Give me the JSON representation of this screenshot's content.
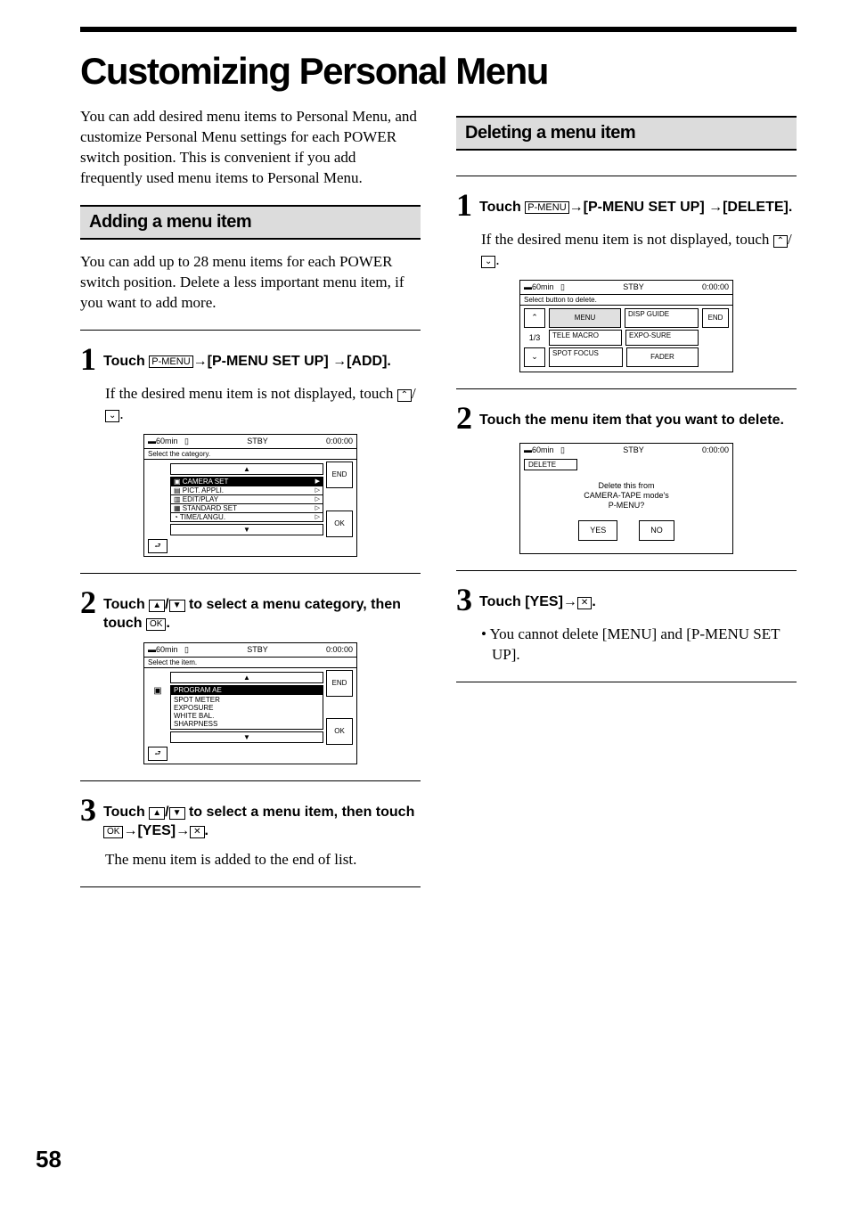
{
  "page_title": "Customizing Personal Menu",
  "intro": "You can add desired menu items to Personal Menu, and customize Personal Menu settings for each POWER switch position. This is convenient if you add frequently used menu items to Personal Menu.",
  "page_number": "58",
  "keycaps": {
    "pmenu": "P-MENU",
    "ok": "OK",
    "x": "✕",
    "up": "▲",
    "down": "▼",
    "chev_up": "⌃",
    "chev_down": "⌄"
  },
  "section_add": {
    "title": "Adding a menu item",
    "intro": "You can add up to 28 menu items for each POWER switch position. Delete a less important menu item, if you want to add more.",
    "step1": {
      "text_pre": "Touch ",
      "text_mid1": "→[P-MENU SET UP] →[ADD].",
      "followup_pre": "If the desired menu item is not displayed, touch ",
      "followup_post": "."
    },
    "step2": {
      "text_pre": "Touch ",
      "text_mid": " to select a menu category, then touch ",
      "text_post": "."
    },
    "step3": {
      "text_pre": "Touch ",
      "text_mid1": " to select a menu item, then touch ",
      "text_mid2": "→[YES]→",
      "text_post": ".",
      "followup": "The menu item is added to the end of list."
    }
  },
  "section_delete": {
    "title": "Deleting a menu item",
    "step1": {
      "text_pre": "Touch ",
      "text_mid1": "→[P-MENU SET UP] →[DELETE].",
      "followup_pre": "If the desired menu item is not displayed, touch ",
      "followup_post": "."
    },
    "step2": {
      "text": "Touch the menu item that you want to delete."
    },
    "step3": {
      "text_pre": "Touch [YES]→",
      "text_post": ".",
      "followup": "• You cannot delete [MENU] and [P-MENU SET UP]."
    }
  },
  "screenshot_common": {
    "battery": "60min",
    "status": "STBY",
    "time": "0:00:00",
    "end": "END",
    "ok": "OK",
    "back": "⮐",
    "up": "▲",
    "down": "▼"
  },
  "screenshot_add1": {
    "title": "Select the category.",
    "items": [
      "CAMERA SET",
      "PICT. APPLI.",
      "EDIT/PLAY",
      "STANDARD SET",
      "TIME/LANGU."
    ]
  },
  "screenshot_add2": {
    "title": "Select the item.",
    "items": [
      "PROGRAM AE",
      "SPOT METER",
      "EXPOSURE",
      "WHITE BAL.",
      "SHARPNESS"
    ]
  },
  "screenshot_del1": {
    "title": "Select button to delete.",
    "page": "1/3",
    "buttons": [
      "MENU",
      "DISP GUIDE",
      "TELE MACRO",
      "EXPO-SURE",
      "SPOT FOCUS",
      "FADER"
    ],
    "end": "END"
  },
  "screenshot_del2": {
    "title": "DELETE",
    "message": "Delete this from\nCAMERA-TAPE mode's\nP-MENU?",
    "yes": "YES",
    "no": "NO"
  }
}
